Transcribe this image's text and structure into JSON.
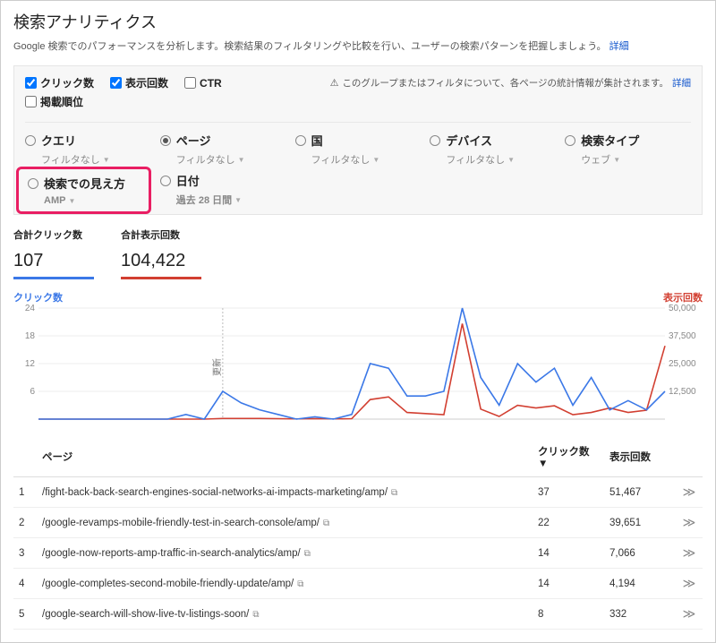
{
  "header": {
    "title": "検索アナリティクス",
    "desc": "Google 検索でのパフォーマンスを分析します。検索結果のフィルタリングや比較を行い、ユーザーの検索パターンを把握しましょう。",
    "more": "詳細"
  },
  "metrics": {
    "clicks": "クリック数",
    "impr": "表示回数",
    "ctr": "CTR",
    "pos": "掲載順位"
  },
  "warning": {
    "text": "このグループまたはフィルタについて、各ページの統計情報が集計されます。",
    "more": "詳細"
  },
  "dimensions": {
    "query": {
      "label": "クエリ",
      "sub": "フィルタなし"
    },
    "page": {
      "label": "ページ",
      "sub": "フィルタなし"
    },
    "country": {
      "label": "国",
      "sub": "フィルタなし"
    },
    "device": {
      "label": "デバイス",
      "sub": "フィルタなし"
    },
    "type": {
      "label": "検索タイプ",
      "sub": "ウェブ"
    },
    "appear": {
      "label": "検索での見え方",
      "sub": "AMP"
    },
    "date": {
      "label": "日付",
      "sub": "過去 28 日間"
    }
  },
  "summary": {
    "clicks_lab": "合計クリック数",
    "clicks_val": "107",
    "impr_lab": "合計表示回数",
    "impr_val": "104,422"
  },
  "chart_data": {
    "type": "line",
    "left_label": "クリック数",
    "right_label": "表示回数",
    "y_left": {
      "max": 24,
      "ticks": [
        6,
        12,
        18,
        24
      ]
    },
    "y_right": {
      "max": 50000,
      "ticks": [
        12500,
        25000,
        37500,
        50000
      ]
    },
    "annotation": "更新",
    "series": [
      {
        "name": "クリック数",
        "color": "#3b78e7",
        "values": [
          0,
          0,
          0,
          0,
          0,
          0,
          0,
          0,
          1,
          0,
          6,
          3.5,
          2,
          1,
          0,
          0.5,
          0,
          1,
          12,
          11,
          5,
          5,
          6,
          24,
          9,
          3,
          12,
          8,
          11,
          3,
          9,
          2,
          4,
          2,
          6
        ]
      },
      {
        "name": "表示回数",
        "color": "#d23f31",
        "values": [
          0,
          0,
          0,
          0,
          0,
          0,
          0,
          0,
          0,
          0,
          300,
          300,
          300,
          200,
          100,
          200,
          100,
          200,
          8800,
          10000,
          3000,
          2500,
          2000,
          43000,
          4500,
          1200,
          6200,
          5000,
          6000,
          2000,
          3000,
          5000,
          3000,
          4000,
          33000
        ]
      }
    ]
  },
  "table": {
    "cols": {
      "page": "ページ",
      "clicks": "クリック数▼",
      "impr": "表示回数"
    },
    "rows": [
      {
        "n": "1",
        "page": "/fight-back-back-search-engines-social-networks-ai-impacts-marketing/amp/",
        "clicks": "37",
        "impr": "51,467"
      },
      {
        "n": "2",
        "page": "/google-revamps-mobile-friendly-test-in-search-console/amp/",
        "clicks": "22",
        "impr": "39,651"
      },
      {
        "n": "3",
        "page": "/google-now-reports-amp-traffic-in-search-analytics/amp/",
        "clicks": "14",
        "impr": "7,066"
      },
      {
        "n": "4",
        "page": "/google-completes-second-mobile-friendly-update/amp/",
        "clicks": "14",
        "impr": "4,194"
      },
      {
        "n": "5",
        "page": "/google-search-will-show-live-tv-listings-soon/",
        "clicks": "8",
        "impr": "332"
      }
    ]
  }
}
